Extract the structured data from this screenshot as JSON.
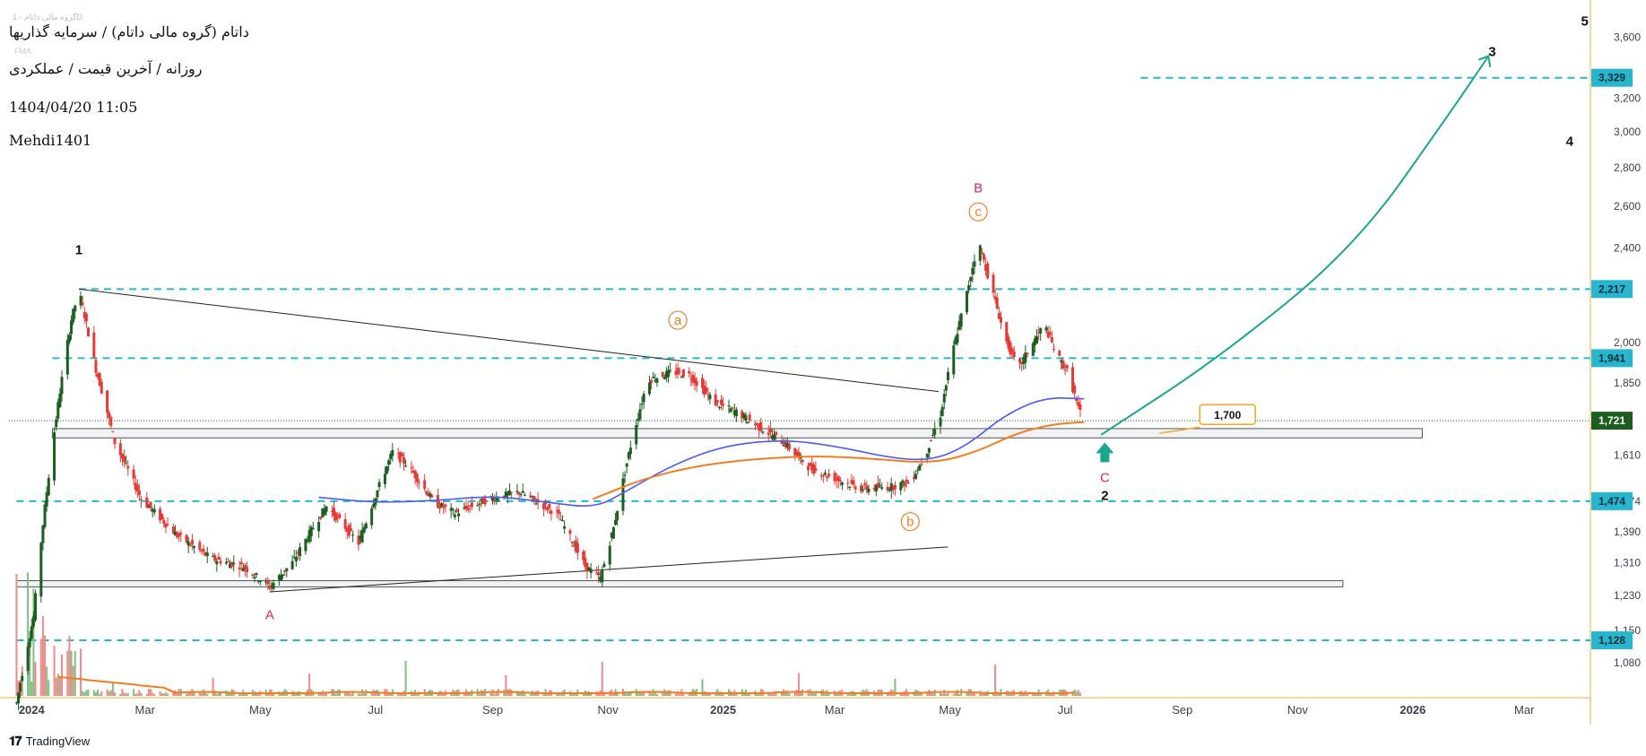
{
  "header": {
    "title": "داتام (گروه مالی داتام) / سرمایه گذاریها",
    "subtitle": "روزانه / آخرین قیمت / عملکردی",
    "datetime": "1404/04/20 11:05",
    "author": "Mehdi1401",
    "watermark": "گروه مالی داتام - 1D",
    "watermark2": "FMA"
  },
  "footer": {
    "brand": "TradingView",
    "logo_icon": "tradingview-logo-icon"
  },
  "colors": {
    "up": "#1b5e20",
    "down": "#e53935",
    "level": "#26b6cf",
    "ma_blue": "#4a5cf0",
    "ma_orange": "#f57c1f",
    "arrow": "#19a68c",
    "accent_orange": "#f5a623",
    "wave_pink": "#e0245e",
    "last_price_bg": "#1b5e20",
    "axis_border": "#f5c97a"
  },
  "chart_data": {
    "type": "candlestick",
    "y_scale": "log",
    "ylim": [
      1010,
      3800
    ],
    "xlim": [
      "2023-12-20",
      "2026-04-05"
    ],
    "y_ticks": [
      "3,600",
      "3,200",
      "3,000",
      "2,800",
      "2,600",
      "2,400",
      "2,000",
      "1,850",
      "1,610",
      "1,474",
      "1,390",
      "1,310",
      "1,230",
      "1,150",
      "1,080"
    ],
    "x_ticks": [
      {
        "label": "2024",
        "date": "2024-01-01",
        "bold": true
      },
      {
        "label": "Mar",
        "date": "2024-03-01"
      },
      {
        "label": "May",
        "date": "2024-05-01"
      },
      {
        "label": "Jul",
        "date": "2024-07-01"
      },
      {
        "label": "Sep",
        "date": "2024-09-01"
      },
      {
        "label": "Nov",
        "date": "2024-11-01"
      },
      {
        "label": "2025",
        "date": "2025-01-01",
        "bold": true
      },
      {
        "label": "Mar",
        "date": "2025-03-01"
      },
      {
        "label": "May",
        "date": "2025-05-01"
      },
      {
        "label": "Jul",
        "date": "2025-07-01"
      },
      {
        "label": "Sep",
        "date": "2025-09-01"
      },
      {
        "label": "Nov",
        "date": "2025-11-01"
      },
      {
        "label": "2026",
        "date": "2026-01-01",
        "bold": true
      },
      {
        "label": "Mar",
        "date": "2026-03-01"
      }
    ],
    "price_anchors": [
      [
        "2023-12-24",
        1000
      ],
      [
        "2024-01-02",
        1180
      ],
      [
        "2024-01-12",
        1640
      ],
      [
        "2024-01-22",
        2090
      ],
      [
        "2024-01-26",
        2210
      ],
      [
        "2024-02-04",
        1900
      ],
      [
        "2024-02-14",
        1650
      ],
      [
        "2024-02-28",
        1480
      ],
      [
        "2024-03-18",
        1380
      ],
      [
        "2024-04-05",
        1320
      ],
      [
        "2024-04-22",
        1300
      ],
      [
        "2024-05-06",
        1250
      ],
      [
        "2024-05-18",
        1310
      ],
      [
        "2024-06-05",
        1460
      ],
      [
        "2024-06-22",
        1360
      ],
      [
        "2024-07-10",
        1620
      ],
      [
        "2024-07-18",
        1580
      ],
      [
        "2024-08-01",
        1470
      ],
      [
        "2024-08-12",
        1440
      ],
      [
        "2024-08-30",
        1480
      ],
      [
        "2024-09-15",
        1500
      ],
      [
        "2024-10-05",
        1440
      ],
      [
        "2024-10-20",
        1300
      ],
      [
        "2024-10-28",
        1270
      ],
      [
        "2024-11-04",
        1400
      ],
      [
        "2024-11-13",
        1640
      ],
      [
        "2024-11-22",
        1860
      ],
      [
        "2024-12-05",
        1890
      ],
      [
        "2024-12-14",
        1880
      ],
      [
        "2024-12-28",
        1780
      ],
      [
        "2025-01-08",
        1750
      ],
      [
        "2025-01-20",
        1700
      ],
      [
        "2025-02-02",
        1650
      ],
      [
        "2025-02-16",
        1570
      ],
      [
        "2025-03-01",
        1540
      ],
      [
        "2025-03-15",
        1510
      ],
      [
        "2025-03-30",
        1515
      ],
      [
        "2025-04-10",
        1530
      ],
      [
        "2025-04-18",
        1610
      ],
      [
        "2025-04-26",
        1740
      ],
      [
        "2025-05-02",
        1950
      ],
      [
        "2025-05-10",
        2200
      ],
      [
        "2025-05-16",
        2430
      ],
      [
        "2025-05-22",
        2250
      ],
      [
        "2025-05-30",
        2020
      ],
      [
        "2025-06-06",
        1900
      ],
      [
        "2025-06-14",
        2000
      ],
      [
        "2025-06-20",
        2070
      ],
      [
        "2025-06-26",
        1960
      ],
      [
        "2025-07-03",
        1880
      ],
      [
        "2025-07-08",
        1760
      ],
      [
        "2025-07-11",
        1721
      ]
    ],
    "ma_blue": [
      [
        "2024-06-01",
        1485
      ],
      [
        "2024-07-01",
        1470
      ],
      [
        "2024-08-01",
        1475
      ],
      [
        "2024-09-01",
        1490
      ],
      [
        "2024-10-01",
        1470
      ],
      [
        "2024-10-25",
        1455
      ],
      [
        "2024-11-10",
        1500
      ],
      [
        "2024-12-05",
        1580
      ],
      [
        "2025-01-01",
        1640
      ],
      [
        "2025-02-01",
        1660
      ],
      [
        "2025-03-01",
        1640
      ],
      [
        "2025-04-01",
        1600
      ],
      [
        "2025-04-22",
        1595
      ],
      [
        "2025-05-10",
        1640
      ],
      [
        "2025-05-30",
        1740
      ],
      [
        "2025-06-20",
        1800
      ],
      [
        "2025-07-11",
        1795
      ]
    ],
    "ma_orange": [
      [
        "2024-10-24",
        1480
      ],
      [
        "2024-11-20",
        1540
      ],
      [
        "2024-12-20",
        1580
      ],
      [
        "2025-01-20",
        1600
      ],
      [
        "2025-02-20",
        1608
      ],
      [
        "2025-03-20",
        1600
      ],
      [
        "2025-04-22",
        1585
      ],
      [
        "2025-05-15",
        1620
      ],
      [
        "2025-06-05",
        1680
      ],
      [
        "2025-06-25",
        1710
      ],
      [
        "2025-07-11",
        1716
      ]
    ],
    "horizontal_levels": [
      {
        "value": 3329,
        "label": "3,329",
        "start": "2025-08-10"
      },
      {
        "value": 2217,
        "label": "2,217",
        "start": "2024-01-26"
      },
      {
        "value": 1941,
        "label": "1,941",
        "start": "2024-01-12"
      },
      {
        "value": 1474,
        "label": "1,474",
        "start": "2023-12-24"
      },
      {
        "value": 1128,
        "label": "1,128",
        "start": "2023-12-24"
      }
    ],
    "last_price": {
      "value": 1721,
      "label": "1,721"
    },
    "zones": [
      {
        "from": "2024-01-12",
        "to": "2026-01-06",
        "low": 1665,
        "high": 1695
      },
      {
        "from": "2023-12-24",
        "to": "2025-11-25",
        "low": 1250,
        "high": 1265
      }
    ],
    "trendlines": [
      {
        "p1": [
          "2024-01-26",
          2217
        ],
        "p2": [
          "2025-04-25",
          1820
        ]
      },
      {
        "p1": [
          "2024-05-06",
          1238
        ],
        "p2": [
          "2025-04-30",
          1350
        ]
      }
    ],
    "projection": {
      "points": [
        [
          "2025-07-20",
          1675
        ],
        [
          "2025-09-20",
          1940
        ],
        [
          "2025-12-01",
          2400
        ],
        [
          "2026-01-20",
          3100
        ],
        [
          "2026-02-10",
          3470
        ]
      ],
      "box": {
        "date": "2025-09-15",
        "value": 1700,
        "label": "1,700"
      }
    },
    "wave_labels": [
      {
        "text": "1",
        "date": "2024-01-26",
        "value": 2370,
        "color": "#111"
      },
      {
        "text": "A",
        "date": "2024-05-06",
        "value": 1175,
        "color": "#e0245e"
      },
      {
        "text": "a",
        "date": "2024-12-08",
        "value": 2070,
        "color": "#f57c1f",
        "circled": true
      },
      {
        "text": "b",
        "date": "2025-04-10",
        "value": 1405,
        "color": "#f57c1f",
        "circled": true
      },
      {
        "text": "c",
        "date": "2025-05-16",
        "value": 2550,
        "color": "#f57c1f",
        "circled": true
      },
      {
        "text": "B",
        "date": "2025-05-16",
        "value": 2670,
        "color": "#e0245e"
      },
      {
        "text": "C",
        "date": "2025-07-22",
        "value": 1530,
        "color": "#e0245e"
      },
      {
        "text": "2",
        "date": "2025-07-22",
        "value": 1478,
        "color": "#111"
      },
      {
        "text": "3",
        "date": "2026-02-12",
        "value": 3470,
        "color": "#111"
      },
      {
        "text": "4",
        "date": "2026-03-25",
        "value": 2920,
        "color": "#111"
      },
      {
        "text": "5",
        "date": "2026-04-02",
        "value": 3680,
        "color": "#111"
      }
    ],
    "volume_panel": {
      "bars_end": "2025-07-11",
      "ma_color": "#f57c1f"
    }
  }
}
